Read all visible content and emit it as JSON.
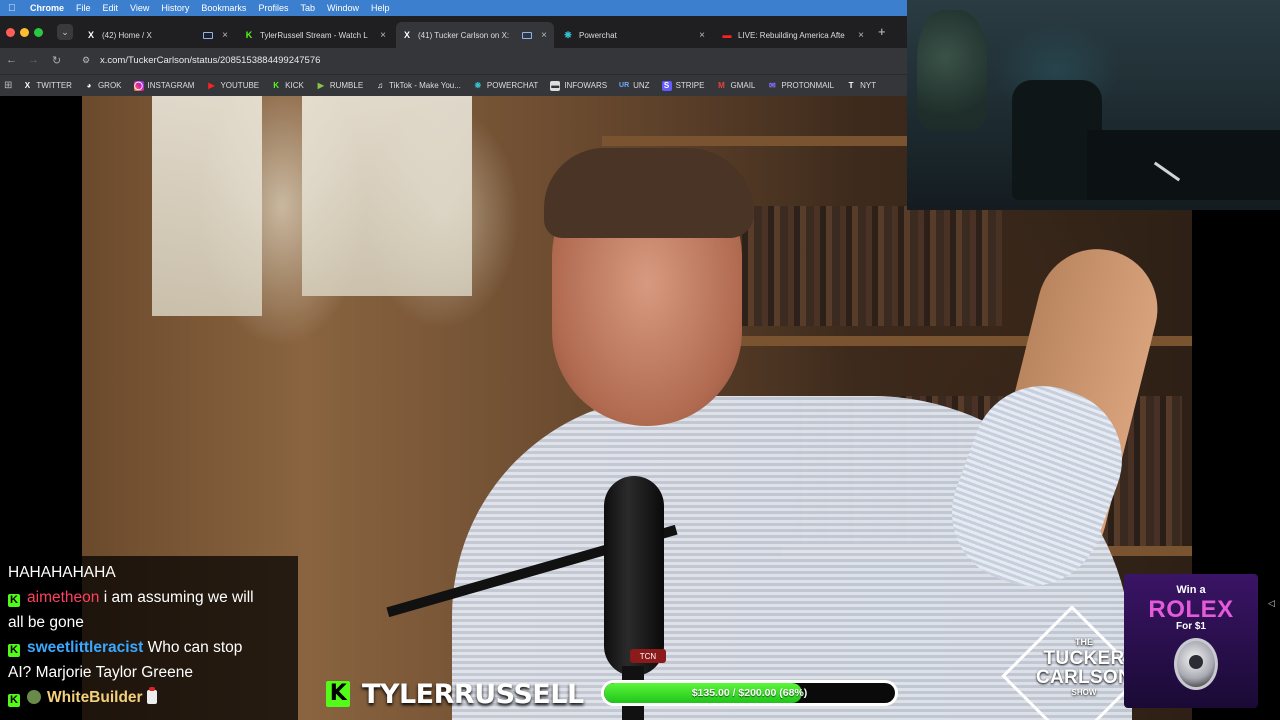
{
  "menubar": {
    "app": "Chrome",
    "items": [
      "File",
      "Edit",
      "View",
      "History",
      "Bookmarks",
      "Profiles",
      "Tab",
      "Window",
      "Help"
    ]
  },
  "tabs": [
    {
      "title": "(42) Home / X",
      "icon": "x-logo-icon"
    },
    {
      "title": "TylerRussell Stream - Watch L",
      "icon": "kick-logo-icon"
    },
    {
      "title": "(41) Tucker Carlson on X:",
      "icon": "x-logo-icon"
    },
    {
      "title": "Powerchat",
      "icon": "powerchat-icon"
    },
    {
      "title": "LIVE: Rebuilding America Afte",
      "icon": "youtube-icon"
    }
  ],
  "toolbar": {
    "url": "x.com/TuckerCarlson/status/2085153884499247576"
  },
  "bookmarks": [
    {
      "label": "TWITTER",
      "icon": "x-logo-icon"
    },
    {
      "label": "GROK",
      "icon": "grok-icon"
    },
    {
      "label": "INSTAGRAM",
      "icon": "instagram-icon"
    },
    {
      "label": "YOUTUBE",
      "icon": "youtube-icon"
    },
    {
      "label": "KICK",
      "icon": "kick-logo-icon"
    },
    {
      "label": "RUMBLE",
      "icon": "rumble-icon"
    },
    {
      "label": "TikTok - Make You...",
      "icon": "tiktok-icon"
    },
    {
      "label": "POWERCHAT",
      "icon": "powerchat-icon"
    },
    {
      "label": "INFOWARS",
      "icon": "infowars-icon"
    },
    {
      "label": "UNZ",
      "icon": "unz-icon"
    },
    {
      "label": "STRIPE",
      "icon": "stripe-icon"
    },
    {
      "label": "GMAIL",
      "icon": "gmail-icon"
    },
    {
      "label": "PROTONMAIL",
      "icon": "protonmail-icon"
    },
    {
      "label": "NYT",
      "icon": "nyt-icon"
    }
  ],
  "chat": {
    "partial_line": "HAHAHAHAHA",
    "messages": [
      {
        "user": "aimetheon",
        "text_a": "i am assuming we will",
        "text_b": "all be gone"
      },
      {
        "user": "sweetlittleracist",
        "text_a": "Who can stop",
        "text_b": "AI? Marjorie Taylor Greene"
      },
      {
        "user": "WhiteBuilder",
        "text_a": "",
        "text_b": ""
      }
    ]
  },
  "stream": {
    "streamer_name": "TYLERRUSSELL",
    "mic_badge": "TCN",
    "goal_label": "$135.00 / $200.00 (68%)",
    "goal_fraction": 0.68
  },
  "logo": {
    "line1": "THE",
    "line2": "TUCKER",
    "line3": "CARLSON",
    "line4": "SHOW"
  },
  "ad": {
    "line1": "Win a",
    "brand": "ROLEX",
    "line3": "For $1"
  },
  "colors": {
    "kick_green": "#53fc18",
    "chat_user_1": "#ff4060",
    "chat_user_2": "#3aa8ff",
    "chat_user_3": "#f3d07a",
    "menubar_blue": "#3d7fcf"
  }
}
